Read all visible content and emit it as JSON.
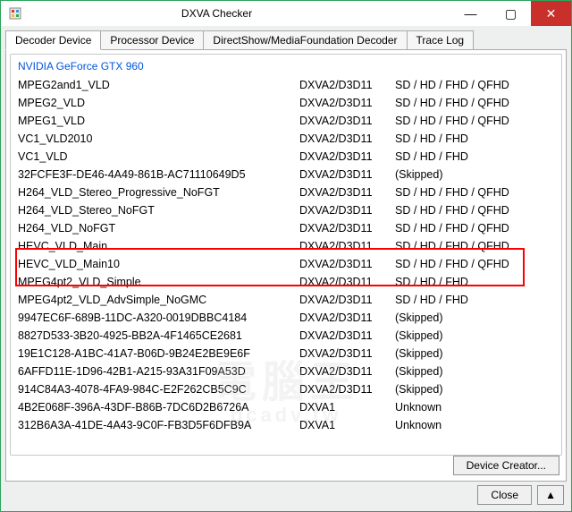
{
  "window": {
    "title": "DXVA Checker"
  },
  "winbuttons": {
    "min": "—",
    "max": "▢",
    "close": "✕"
  },
  "tabs": [
    {
      "label": "Decoder Device",
      "active": true
    },
    {
      "label": "Processor Device",
      "active": false
    },
    {
      "label": "DirectShow/MediaFoundation Decoder",
      "active": false
    },
    {
      "label": "Trace Log",
      "active": false
    }
  ],
  "device": {
    "name": "NVIDIA GeForce GTX 960"
  },
  "rows": [
    {
      "name": "MPEG2and1_VLD",
      "api": "DXVA2/D3D11",
      "res": "SD / HD / FHD / QFHD"
    },
    {
      "name": "MPEG2_VLD",
      "api": "DXVA2/D3D11",
      "res": "SD / HD / FHD / QFHD"
    },
    {
      "name": "MPEG1_VLD",
      "api": "DXVA2/D3D11",
      "res": "SD / HD / FHD / QFHD"
    },
    {
      "name": "VC1_VLD2010",
      "api": "DXVA2/D3D11",
      "res": "SD / HD / FHD"
    },
    {
      "name": "VC1_VLD",
      "api": "DXVA2/D3D11",
      "res": "SD / HD / FHD"
    },
    {
      "name": "32FCFE3F-DE46-4A49-861B-AC71110649D5",
      "api": "DXVA2/D3D11",
      "res": "(Skipped)"
    },
    {
      "name": "H264_VLD_Stereo_Progressive_NoFGT",
      "api": "DXVA2/D3D11",
      "res": "SD / HD / FHD / QFHD"
    },
    {
      "name": "H264_VLD_Stereo_NoFGT",
      "api": "DXVA2/D3D11",
      "res": "SD / HD / FHD / QFHD"
    },
    {
      "name": "H264_VLD_NoFGT",
      "api": "DXVA2/D3D11",
      "res": "SD / HD / FHD / QFHD"
    },
    {
      "name": "HEVC_VLD_Main",
      "api": "DXVA2/D3D11",
      "res": "SD / HD / FHD / QFHD"
    },
    {
      "name": "HEVC_VLD_Main10",
      "api": "DXVA2/D3D11",
      "res": "SD / HD / FHD / QFHD"
    },
    {
      "name": "MPEG4pt2_VLD_Simple",
      "api": "DXVA2/D3D11",
      "res": "SD / HD / FHD"
    },
    {
      "name": "MPEG4pt2_VLD_AdvSimple_NoGMC",
      "api": "DXVA2/D3D11",
      "res": "SD / HD / FHD"
    },
    {
      "name": "9947EC6F-689B-11DC-A320-0019DBBC4184",
      "api": "DXVA2/D3D11",
      "res": "(Skipped)"
    },
    {
      "name": "8827D533-3B20-4925-BB2A-4F1465CE2681",
      "api": "DXVA2/D3D11",
      "res": "(Skipped)"
    },
    {
      "name": "19E1C128-A1BC-41A7-B06D-9B24E2BE9E6F",
      "api": "DXVA2/D3D11",
      "res": "(Skipped)"
    },
    {
      "name": "6AFFD11E-1D96-42B1-A215-93A31F09A53D",
      "api": "DXVA2/D3D11",
      "res": "(Skipped)"
    },
    {
      "name": "914C84A3-4078-4FA9-984C-E2F262CB5C9C",
      "api": "DXVA2/D3D11",
      "res": "(Skipped)"
    },
    {
      "name": "4B2E068F-396A-43DF-B86B-7DC6D2B6726A",
      "api": "DXVA1",
      "res": "Unknown"
    },
    {
      "name": "312B6A3A-41DE-4A43-9C0F-FB3D5F6DFB9A",
      "api": "DXVA1",
      "res": "Unknown"
    }
  ],
  "buttons": {
    "device_creator": "Device Creator...",
    "close": "Close",
    "up": "▲"
  },
  "watermark": {
    "line1": "電腦王",
    "line2": "pcadv.tw"
  }
}
